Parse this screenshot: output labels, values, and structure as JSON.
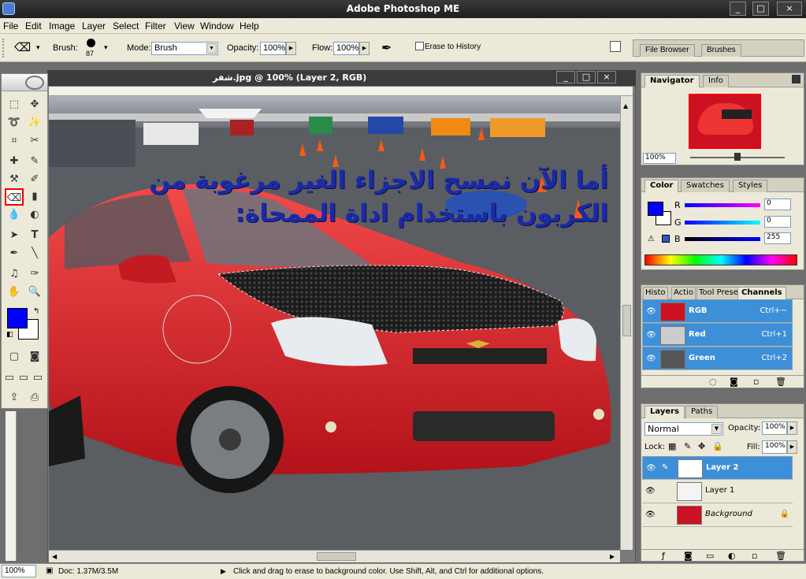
{
  "window": {
    "title": "Adobe Photoshop ME",
    "buttons": [
      "_",
      "□",
      "×"
    ]
  },
  "menu": [
    "File",
    "Edit",
    "Image",
    "Layer",
    "Select",
    "Filter",
    "View",
    "Window",
    "Help"
  ],
  "options": {
    "brush_label": "Brush:",
    "brush_size": "87",
    "mode_label": "Mode:",
    "mode_value": "Brush",
    "opacity_label": "Opacity:",
    "opacity_value": "100%",
    "flow_label": "Flow:",
    "flow_value": "100%",
    "erase_history": "Erase to History",
    "palette_well_tabs": [
      "File Browser",
      "Brushes"
    ]
  },
  "document": {
    "title": "شفر.jpg @ 100% (Layer 2, RGB)",
    "overlay_text_line1": "أما الآن نمسح الاجزاء الغير مرغوبة من",
    "overlay_text_line2": "الكربون باستخدام اداة الممحاة:"
  },
  "navigator": {
    "tabs": [
      "Navigator",
      "Info"
    ],
    "zoom": "100%"
  },
  "color_panel": {
    "tabs": [
      "Color",
      "Swatches",
      "Styles"
    ],
    "labels": [
      "R",
      "G",
      "B"
    ],
    "values": [
      "0",
      "0",
      "255"
    ],
    "foreground": "#0000ff",
    "background": "#ffffff"
  },
  "channels_panel": {
    "tabs": [
      "Histo",
      "Actio",
      "Tool Prese",
      "Channels"
    ],
    "rows": [
      {
        "name": "RGB",
        "shortcut": "Ctrl+~"
      },
      {
        "name": "Red",
        "shortcut": "Ctrl+1"
      },
      {
        "name": "Green",
        "shortcut": "Ctrl+2"
      }
    ]
  },
  "layers_panel": {
    "tabs": [
      "Layers",
      "Paths"
    ],
    "blend_mode": "Normal",
    "opacity_label": "Opacity:",
    "opacity_value": "100%",
    "lock_label": "Lock:",
    "fill_label": "Fill:",
    "fill_value": "100%",
    "layers": [
      {
        "name": "Layer 2"
      },
      {
        "name": "Layer 1"
      },
      {
        "name": "Background"
      }
    ]
  },
  "status": {
    "zoom": "100%",
    "doc": "Doc: 1.37M/3.5M",
    "hint": "Click and drag to erase to background color.  Use Shift, Alt, and Ctrl for additional options."
  },
  "colors": {
    "selection": "#3d8fd8",
    "accent_red": "#e00000"
  }
}
